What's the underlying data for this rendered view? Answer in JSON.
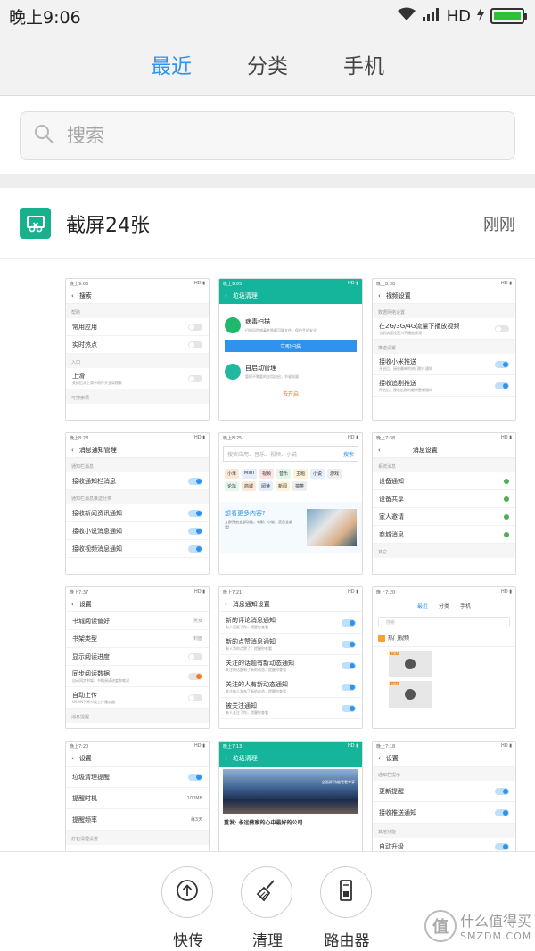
{
  "status_bar": {
    "time": "晚上9:06",
    "network": "HD",
    "battery_level": 1.0
  },
  "tabs": [
    {
      "label": "最近",
      "active": true
    },
    {
      "label": "分类",
      "active": false
    },
    {
      "label": "手机",
      "active": false
    }
  ],
  "search": {
    "placeholder": "搜索"
  },
  "group": {
    "title": "截屏24张",
    "time": "刚刚"
  },
  "thumbnails": {
    "t1": {
      "time": "晚上9:06",
      "title": "搜索",
      "section1": "帮助",
      "rows": [
        "常用应用",
        "实时热点"
      ],
      "section2": "入口",
      "row3": "上滑",
      "row3_sub": "关闭后从上滑不再打开全局搜索",
      "section3": "可搜索项"
    },
    "t2": {
      "time": "晚上9:05",
      "title": "垃圾清理",
      "card1_title": "病毒扫描",
      "card1_sub": "扫描风险病毒并隐藏可疑文件，保护手机安全",
      "card1_button": "立即扫描",
      "card2_title": "自启动管理",
      "card2_sub": "管理不需要的应用自启，节省电量",
      "card2_link": "去开启"
    },
    "t3": {
      "time": "晚上8:30",
      "title": "视频设置",
      "section1": "数据网络设置",
      "row1": "在2G/3G/4G流量下播放视频",
      "row1_sub": "当前流量设置为不播放视频",
      "section2": "推送设置",
      "row2": "接收小米推送",
      "row2_sub": "开启后，接收最新的热门影片通知",
      "row3": "接收追剧推送",
      "row3_sub": "开启后，接收追剧的最新更新通知"
    },
    "t4": {
      "time": "晚上8:28",
      "title": "消息通知管理",
      "section1": "通知栏消息",
      "row1": "接收通知栏消息",
      "section2": "通知栏消息推送分类",
      "rows": [
        "接收新闻资讯通知",
        "接收小说消息通知",
        "接收视频消息通知"
      ]
    },
    "t5": {
      "time": "晚上8:25",
      "search_text": "搜索应用、音乐、视频、小说",
      "search_button": "搜索",
      "chips": [
        "小米",
        "MIUI",
        "视频",
        "音乐",
        "主题",
        "小说",
        "游戏",
        "论坛",
        "商城",
        "阅读",
        "新闻",
        "搞笑"
      ],
      "promo_title": "想看更多内容?",
      "promo_sub": "立即开启全部功能，电影、小说、音乐全都看!"
    },
    "t6": {
      "time": "晚上7:38",
      "title": "消息设置",
      "section1": "系统消息",
      "rows": [
        "设备通知",
        "设备共享",
        "家人邀请",
        "商城消息"
      ],
      "section2": "其它"
    },
    "t7": {
      "time": "晚上7:37",
      "title": "设置",
      "rows": [
        "书城阅读偏好",
        "书架类型",
        "显示阅读进度",
        "同步阅读数据",
        "自动上传"
      ],
      "values": [
        "男女",
        "封面"
      ],
      "row4_sub": "自动同步书架、书籍阅读进度和笔记",
      "row5_sub": "WLAN下将书架上传服务器",
      "section1": "消息提醒"
    },
    "t8": {
      "time": "晚上7:21",
      "title": "消息通知设置",
      "rows": [
        "新的评论消息通知",
        "新的点赞消息通知",
        "关注的话题有新动态通知",
        "关注的人有新动态通知",
        "被关注通知"
      ],
      "subs": [
        "有人回复了你，提醒你查看",
        "有人为你点赞了，提醒你查看",
        "关注的话题有了新的动态，提醒你查看",
        "关注的人发布了新的动态，提醒你查看",
        "有人关注了你，提醒你查看"
      ]
    },
    "t9": {
      "time": "晚上7:20",
      "tabs": [
        "最近",
        "分类",
        "手机"
      ],
      "search": "搜索",
      "group_title": "热门视频",
      "badge": "小说人"
    },
    "t10": {
      "time": "晚上7:20",
      "title": "设置",
      "rows": [
        "垃圾清理提醒",
        "提醒时机",
        "提醒频率"
      ],
      "values": [
        "100MB",
        "每3天"
      ],
      "section1": "打包清理设置"
    },
    "t11": {
      "time": "晚上7:13",
      "title": "垃圾清理",
      "photo_text": "全面屏 功能看看专享",
      "news": "重发: 永远做家的心中最好的公司"
    },
    "t12": {
      "time": "晚上7:18",
      "title": "设置",
      "section1": "通知栏提示",
      "rows": [
        "更新提醒",
        "接收推送通知"
      ],
      "section2": "其他功能",
      "row3": "自动升级"
    }
  },
  "actions": [
    {
      "label": "快传",
      "icon": "upload-icon"
    },
    {
      "label": "清理",
      "icon": "broom-icon"
    },
    {
      "label": "路由器",
      "icon": "router-icon"
    }
  ],
  "watermark": {
    "cn": "什么值得买",
    "en": "SMZDM.COM",
    "logo": "值"
  },
  "colors": {
    "accent": "#2f93ee",
    "group_icon": "#17b18e",
    "battery": "#2fbf38"
  }
}
